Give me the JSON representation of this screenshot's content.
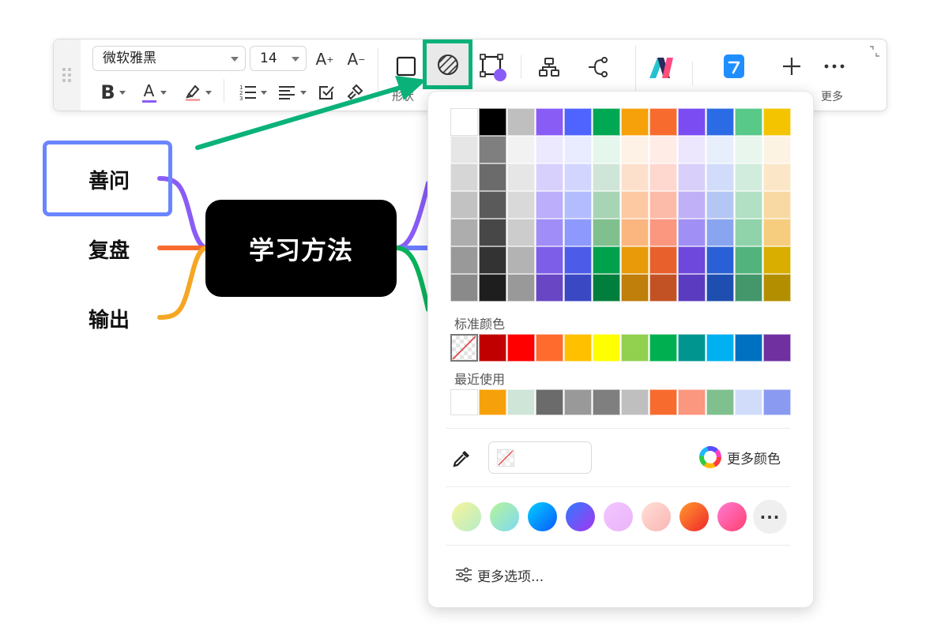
{
  "toolbar": {
    "font_family": "微软雅黑",
    "font_size": "14",
    "font_increase": "A",
    "font_decrease": "A",
    "bold": "B",
    "font_color": "A",
    "shape_label": "形状",
    "more_label": "更多"
  },
  "mindmap": {
    "central": "学习方法",
    "branches": [
      "善问",
      "复盘",
      "输出"
    ],
    "branch_colors": [
      "#8a5cf6",
      "#f86b2f",
      "#f5a623"
    ],
    "right_branch_colors": [
      "#8a5cf6",
      "#6a7bff",
      "#0ab25b"
    ]
  },
  "color_picker": {
    "palette": [
      [
        "#ffffff",
        "#000000",
        "#bfbfbf",
        "#8a5cf6",
        "#4f63ff",
        "#00a854",
        "#f7a10a",
        "#f86b2f",
        "#7b4cf2",
        "#2c6be6",
        "#59c98a",
        "#f5c400"
      ],
      [
        "#e6e6e6",
        "#7f7f7f",
        "#f2f2f2",
        "#ece8fe",
        "#e9ebff",
        "#e5f6ec",
        "#fef1e6",
        "#ffece6",
        "#ece7fd",
        "#e7eefc",
        "#e8f6ee",
        "#fdf3e3"
      ],
      [
        "#d6d6d6",
        "#6b6b6b",
        "#e6e6e6",
        "#d8d0fc",
        "#d2d6ff",
        "#cfe5d8",
        "#fde0cc",
        "#fed7cf",
        "#d8cffb",
        "#d0dcf9",
        "#d1ecdd",
        "#fbe7c8"
      ],
      [
        "#c2c2c2",
        "#5a5a5a",
        "#d9d9d9",
        "#bcaefa",
        "#b3bcff",
        "#a8d4b6",
        "#fcc9a3",
        "#fcbba8",
        "#bfb0f8",
        "#b4c6f4",
        "#b1e0c4",
        "#f9d9a3"
      ],
      [
        "#adadad",
        "#474747",
        "#cccccc",
        "#a08df7",
        "#8d99fd",
        "#7fc08e",
        "#fbb67f",
        "#fb967f",
        "#a090f5",
        "#8aa5ef",
        "#90d3aa",
        "#f6cd7e"
      ],
      [
        "#999999",
        "#333333",
        "#b3b3b3",
        "#7d5ee8",
        "#4c5be8",
        "#00a14c",
        "#e89a09",
        "#e8602b",
        "#6e48dd",
        "#2a60d5",
        "#52b47c",
        "#d9ae00"
      ],
      [
        "#8a8a8a",
        "#1e1e1e",
        "#999999",
        "#6846c4",
        "#3b48c4",
        "#007e3b",
        "#c07e0b",
        "#c25223",
        "#5b3cc0",
        "#1e4eb0",
        "#43976a",
        "#b38f00"
      ]
    ],
    "standard_label": "标准颜色",
    "standard_colors": [
      "#c00000",
      "#ff0000",
      "#ff6b2d",
      "#ffc000",
      "#ffff00",
      "#92d050",
      "#00b050",
      "#00968f",
      "#00b0f0",
      "#0070c0",
      "#7030a0"
    ],
    "recent_label": "最近使用",
    "recent_colors": [
      "#ffffff",
      "#f7a10a",
      "#cfe5d8",
      "#6b6b6b",
      "#999999",
      "#7f7f7f",
      "#bfbfbf",
      "#f86b2f",
      "#fb967f",
      "#7fc08e",
      "#d0dcf9",
      "#8a9af0"
    ],
    "more_colors_label": "更多颜色",
    "more_options_label": "更多选项...",
    "gradients": [
      [
        "#f7f59a",
        "#b6ecc8"
      ],
      [
        "#b6f59a",
        "#7fd8f2"
      ],
      [
        "#00d0ff",
        "#0a58ff"
      ],
      [
        "#2f7bff",
        "#a535f0"
      ],
      [
        "#f3c5ff",
        "#e9b4f8"
      ],
      [
        "#ffe0d6",
        "#fbb4b4"
      ],
      [
        "#ff9a2c",
        "#f0262c"
      ],
      [
        "#ff7ad2",
        "#ff4070"
      ]
    ],
    "more_gradients": "···"
  },
  "accent": "#0ab27a"
}
